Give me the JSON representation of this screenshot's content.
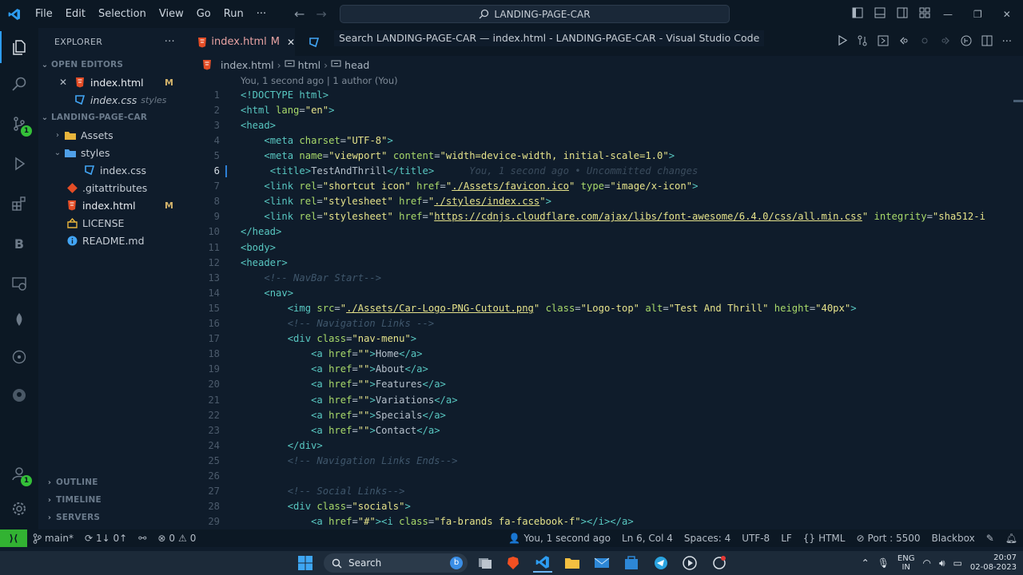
{
  "titlebar": {
    "menus": [
      "File",
      "Edit",
      "Selection",
      "View",
      "Go",
      "Run",
      "···"
    ],
    "search_text": "LANDING-PAGE-CAR",
    "tooltip": "Search LANDING-PAGE-CAR — index.html - LANDING-PAGE-CAR - Visual Studio Code"
  },
  "activity": {
    "source_control_badge": "1",
    "accounts_badge": "1"
  },
  "sidebar": {
    "title": "EXPLORER",
    "more": "···",
    "open_editors_label": "OPEN EDITORS",
    "open_editors": [
      {
        "name": "index.html",
        "status": "M"
      },
      {
        "name": "index.css",
        "folder": "styles"
      }
    ],
    "workspace_label": "LANDING-PAGE-CAR",
    "tree": [
      {
        "name": "Assets",
        "kind": "folder"
      },
      {
        "name": "styles",
        "kind": "folder-open"
      },
      {
        "name": "index.css",
        "kind": "css"
      },
      {
        "name": ".gitattributes",
        "kind": "git"
      },
      {
        "name": "index.html",
        "kind": "html",
        "status": "M"
      },
      {
        "name": "LICENSE",
        "kind": "license"
      },
      {
        "name": "README.md",
        "kind": "info"
      }
    ],
    "bottom_sections": [
      "OUTLINE",
      "TIMELINE",
      "SERVERS"
    ]
  },
  "tabs": [
    {
      "label": "index.html",
      "status": "M"
    },
    {
      "label": "index.css"
    }
  ],
  "breadcrumb": [
    "index.html",
    "html",
    "head"
  ],
  "blame": "You, 1 second ago | 1 author (You)",
  "inline_blame": "You, 1 second ago • Uncommitted changes",
  "code": {
    "current_line": 6,
    "lines": [
      [
        [
          "t",
          "<!DOCTYPE html>"
        ]
      ],
      [
        [
          "t",
          "<html "
        ],
        [
          "a",
          "lang"
        ],
        [
          "p",
          "="
        ],
        [
          "s",
          "\"en\""
        ],
        [
          "t",
          ">"
        ]
      ],
      [
        [
          "t",
          "<head>"
        ]
      ],
      [
        [
          "p",
          "    "
        ],
        [
          "t",
          "<meta "
        ],
        [
          "a",
          "charset"
        ],
        [
          "p",
          "="
        ],
        [
          "s",
          "\"UTF-8\""
        ],
        [
          "t",
          ">"
        ]
      ],
      [
        [
          "p",
          "    "
        ],
        [
          "t",
          "<meta "
        ],
        [
          "a",
          "name"
        ],
        [
          "p",
          "="
        ],
        [
          "s",
          "\"viewport\" "
        ],
        [
          "a",
          "content"
        ],
        [
          "p",
          "="
        ],
        [
          "s",
          "\"width=device-width, initial-scale=1.0\""
        ],
        [
          "t",
          ">"
        ]
      ],
      [
        [
          "p",
          "     "
        ],
        [
          "t",
          "<title>"
        ],
        [
          "p",
          "TestAndThrill"
        ],
        [
          "t",
          "</title>"
        ]
      ],
      [
        [
          "p",
          "    "
        ],
        [
          "t",
          "<link "
        ],
        [
          "a",
          "rel"
        ],
        [
          "p",
          "="
        ],
        [
          "s",
          "\"shortcut icon\" "
        ],
        [
          "a",
          "href"
        ],
        [
          "p",
          "="
        ],
        [
          "s",
          "\""
        ],
        [
          "u",
          "./Assets/favicon.ico"
        ],
        [
          "s",
          "\" "
        ],
        [
          "a",
          "type"
        ],
        [
          "p",
          "="
        ],
        [
          "s",
          "\"image/x-icon\""
        ],
        [
          "t",
          ">"
        ]
      ],
      [
        [
          "p",
          "    "
        ],
        [
          "t",
          "<link "
        ],
        [
          "a",
          "rel"
        ],
        [
          "p",
          "="
        ],
        [
          "s",
          "\"stylesheet\" "
        ],
        [
          "a",
          "href"
        ],
        [
          "p",
          "="
        ],
        [
          "s",
          "\""
        ],
        [
          "u",
          "./styles/index.css"
        ],
        [
          "s",
          "\""
        ],
        [
          "t",
          ">"
        ]
      ],
      [
        [
          "p",
          "    "
        ],
        [
          "t",
          "<link "
        ],
        [
          "a",
          "rel"
        ],
        [
          "p",
          "="
        ],
        [
          "s",
          "\"stylesheet\" "
        ],
        [
          "a",
          "href"
        ],
        [
          "p",
          "="
        ],
        [
          "s",
          "\""
        ],
        [
          "u",
          "https://cdnjs.cloudflare.com/ajax/libs/font-awesome/6.4.0/css/all.min.css"
        ],
        [
          "s",
          "\" "
        ],
        [
          "a",
          "integrity"
        ],
        [
          "p",
          "="
        ],
        [
          "s",
          "\"sha512-i"
        ]
      ],
      [
        [
          "t",
          "</head>"
        ]
      ],
      [
        [
          "t",
          "<body>"
        ]
      ],
      [
        [
          "t",
          "<header>"
        ]
      ],
      [
        [
          "p",
          "    "
        ],
        [
          "c",
          "<!-- NavBar Start-->"
        ]
      ],
      [
        [
          "p",
          "    "
        ],
        [
          "t",
          "<nav>"
        ]
      ],
      [
        [
          "p",
          "        "
        ],
        [
          "t",
          "<img "
        ],
        [
          "a",
          "src"
        ],
        [
          "p",
          "="
        ],
        [
          "s",
          "\""
        ],
        [
          "u",
          "./Assets/Car-Logo-PNG-Cutout.png"
        ],
        [
          "s",
          "\" "
        ],
        [
          "a",
          "class"
        ],
        [
          "p",
          "="
        ],
        [
          "s",
          "\"Logo-top\" "
        ],
        [
          "a",
          "alt"
        ],
        [
          "p",
          "="
        ],
        [
          "s",
          "\"Test And Thrill\" "
        ],
        [
          "a",
          "height"
        ],
        [
          "p",
          "="
        ],
        [
          "s",
          "\"40px\""
        ],
        [
          "t",
          ">"
        ]
      ],
      [
        [
          "p",
          "        "
        ],
        [
          "c",
          "<!-- Navigation Links -->"
        ]
      ],
      [
        [
          "p",
          "        "
        ],
        [
          "t",
          "<div "
        ],
        [
          "a",
          "class"
        ],
        [
          "p",
          "="
        ],
        [
          "s",
          "\"nav-menu\""
        ],
        [
          "t",
          ">"
        ]
      ],
      [
        [
          "p",
          "            "
        ],
        [
          "t",
          "<a "
        ],
        [
          "a",
          "href"
        ],
        [
          "p",
          "="
        ],
        [
          "s",
          "\"\""
        ],
        [
          "t",
          ">"
        ],
        [
          "p",
          "Home"
        ],
        [
          "t",
          "</a>"
        ]
      ],
      [
        [
          "p",
          "            "
        ],
        [
          "t",
          "<a "
        ],
        [
          "a",
          "href"
        ],
        [
          "p",
          "="
        ],
        [
          "s",
          "\"\""
        ],
        [
          "t",
          ">"
        ],
        [
          "p",
          "About"
        ],
        [
          "t",
          "</a>"
        ]
      ],
      [
        [
          "p",
          "            "
        ],
        [
          "t",
          "<a "
        ],
        [
          "a",
          "href"
        ],
        [
          "p",
          "="
        ],
        [
          "s",
          "\"\""
        ],
        [
          "t",
          ">"
        ],
        [
          "p",
          "Features"
        ],
        [
          "t",
          "</a>"
        ]
      ],
      [
        [
          "p",
          "            "
        ],
        [
          "t",
          "<a "
        ],
        [
          "a",
          "href"
        ],
        [
          "p",
          "="
        ],
        [
          "s",
          "\"\""
        ],
        [
          "t",
          ">"
        ],
        [
          "p",
          "Variations"
        ],
        [
          "t",
          "</a>"
        ]
      ],
      [
        [
          "p",
          "            "
        ],
        [
          "t",
          "<a "
        ],
        [
          "a",
          "href"
        ],
        [
          "p",
          "="
        ],
        [
          "s",
          "\"\""
        ],
        [
          "t",
          ">"
        ],
        [
          "p",
          "Specials"
        ],
        [
          "t",
          "</a>"
        ]
      ],
      [
        [
          "p",
          "            "
        ],
        [
          "t",
          "<a "
        ],
        [
          "a",
          "href"
        ],
        [
          "p",
          "="
        ],
        [
          "s",
          "\"\""
        ],
        [
          "t",
          ">"
        ],
        [
          "p",
          "Contact"
        ],
        [
          "t",
          "</a>"
        ]
      ],
      [
        [
          "p",
          "        "
        ],
        [
          "t",
          "</div>"
        ]
      ],
      [
        [
          "p",
          "        "
        ],
        [
          "c",
          "<!-- Navigation Links Ends-->"
        ]
      ],
      [],
      [
        [
          "p",
          "        "
        ],
        [
          "c",
          "<!-- Social Links-->"
        ]
      ],
      [
        [
          "p",
          "        "
        ],
        [
          "t",
          "<div "
        ],
        [
          "a",
          "class"
        ],
        [
          "p",
          "="
        ],
        [
          "s",
          "\"socials\""
        ],
        [
          "t",
          ">"
        ]
      ],
      [
        [
          "p",
          "            "
        ],
        [
          "t",
          "<a "
        ],
        [
          "a",
          "href"
        ],
        [
          "p",
          "="
        ],
        [
          "s",
          "\"#\""
        ],
        [
          "t",
          ">"
        ],
        [
          "t",
          "<i "
        ],
        [
          "a",
          "class"
        ],
        [
          "p",
          "="
        ],
        [
          "s",
          "\"fa-brands fa-facebook-f\""
        ],
        [
          "t",
          ">"
        ],
        [
          "t",
          "</i>"
        ],
        [
          "t",
          "</a>"
        ]
      ]
    ]
  },
  "status": {
    "branch": "main*",
    "sync": "1↓ 0↑",
    "problems": "0",
    "warnings": "0",
    "blame": "You, 1 second ago",
    "position": "Ln 6, Col 4",
    "spaces": "Spaces: 4",
    "encoding": "UTF-8",
    "eol": "LF",
    "language": "HTML",
    "port": "Port : 5500",
    "ext": "Blackbox"
  },
  "taskbar": {
    "search": "Search",
    "lang_line1": "ENG",
    "lang_line2": "IN",
    "time": "20:07",
    "date": "02-08-2023"
  }
}
